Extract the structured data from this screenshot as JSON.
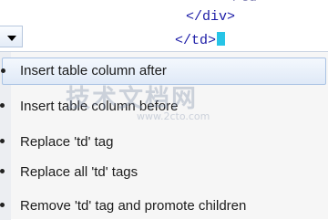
{
  "editor": {
    "lines": [
      "</td>",
      "</div>",
      "</td>"
    ]
  },
  "smart_tag": {
    "icon": "chevron-down-icon"
  },
  "menu": {
    "items": [
      {
        "label": "Insert table column after",
        "highlighted": true
      },
      {
        "label": "Insert table column before",
        "highlighted": false
      },
      {
        "label": "Replace 'td' tag",
        "highlighted": false
      },
      {
        "label": "Replace all 'td' tags",
        "highlighted": false
      },
      {
        "label": "Remove 'td' tag and promote children",
        "highlighted": false
      }
    ]
  },
  "watermark": {
    "title": "技术文档网",
    "subtitle": "www.2cto.com"
  },
  "colors": {
    "caret": "#27c4e6",
    "tag_text": "#1a1aa6",
    "highlight_border": "#aac3e4"
  }
}
